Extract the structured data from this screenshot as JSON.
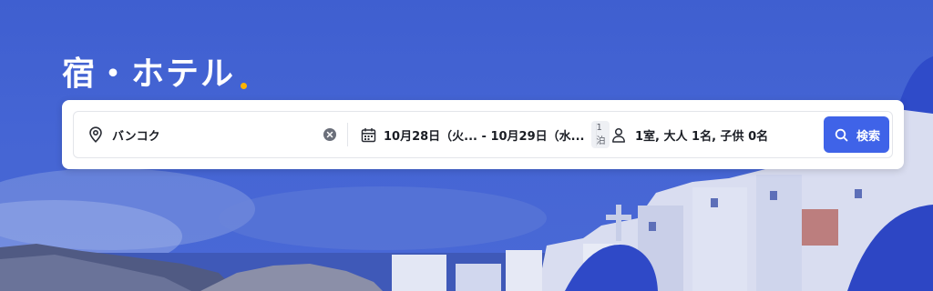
{
  "hero": {
    "title": "宿・ホテル"
  },
  "search": {
    "destination": "バンコク",
    "dates": "10月28日（火... - 10月29日（水...",
    "nights": "1泊",
    "guests": "1室, 大人 1名, 子供 0名",
    "button_label": "検索"
  },
  "colors": {
    "accent": "#3f63e8",
    "dot": "#ffb400",
    "background": "#4565d4"
  },
  "icons": [
    "location-pin-icon",
    "clear-icon",
    "calendar-icon",
    "person-icon",
    "search-icon"
  ]
}
